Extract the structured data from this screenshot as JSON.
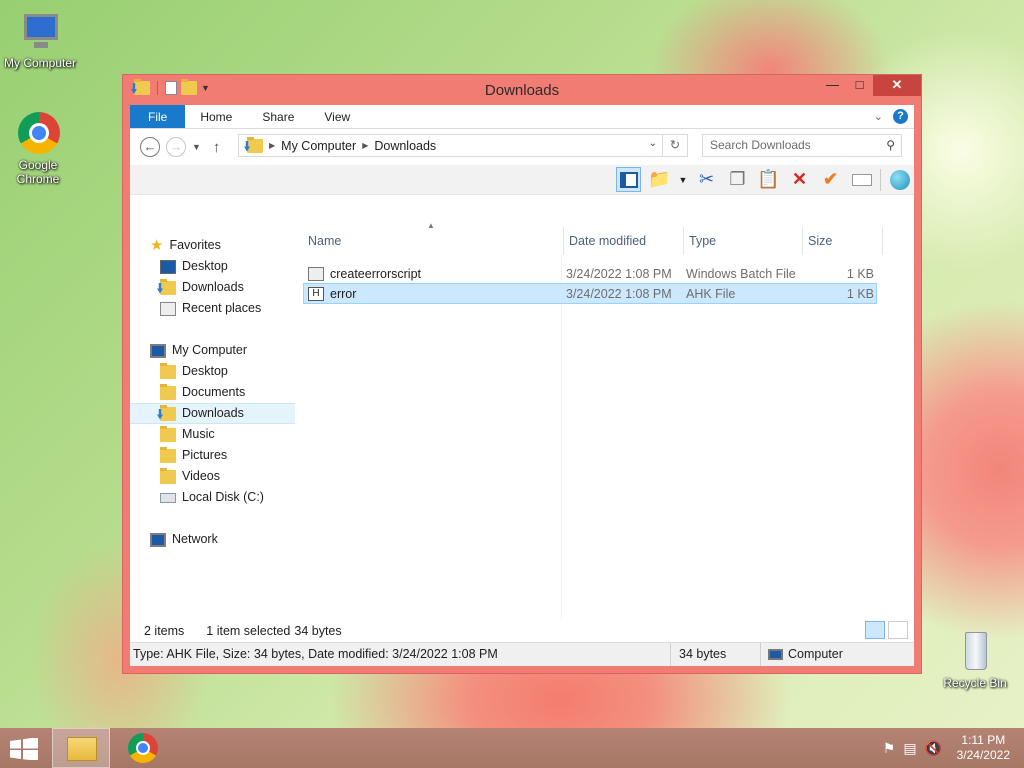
{
  "desktop": {
    "icons": [
      {
        "label": "My Computer"
      },
      {
        "label": "Google Chrome"
      },
      {
        "label": "Recycle Bin"
      }
    ]
  },
  "window": {
    "title": "Downloads",
    "ribbon_tabs": [
      "File",
      "Home",
      "Share",
      "View"
    ],
    "address": {
      "crumbs": [
        "My Computer",
        "Downloads"
      ]
    },
    "search_placeholder": "Search Downloads",
    "columns": [
      "Name",
      "Date modified",
      "Type",
      "Size"
    ],
    "files": [
      {
        "name": "createerrorscript",
        "date": "3/24/2022 1:08 PM",
        "type": "Windows Batch File",
        "size": "1 KB",
        "icon": "batch-file-icon",
        "selected": false
      },
      {
        "name": "error",
        "date": "3/24/2022 1:08 PM",
        "type": "AHK File",
        "size": "1 KB",
        "icon": "ahk-file-icon",
        "selected": true
      }
    ],
    "sidebar": {
      "favorites_label": "Favorites",
      "favorites": [
        "Desktop",
        "Downloads",
        "Recent places"
      ],
      "computer_label": "My Computer",
      "computer": [
        "Desktop",
        "Documents",
        "Downloads",
        "Music",
        "Pictures",
        "Videos",
        "Local Disk (C:)"
      ],
      "network_label": "Network",
      "active": "Downloads"
    },
    "status": {
      "items": "2 items",
      "selected": "1 item selected",
      "bytes": "34 bytes",
      "details": "Type: AHK File, Size: 34 bytes, Date modified: 3/24/2022 1:08 PM",
      "size": "34 bytes",
      "location": "Computer"
    }
  },
  "taskbar": {
    "time": "1:11 PM",
    "date": "3/24/2022"
  },
  "colors": {
    "title_bar": "#f17c74",
    "file_tab": "#1979ca",
    "selection": "#cce8ff",
    "close_button": "#c7453e"
  }
}
